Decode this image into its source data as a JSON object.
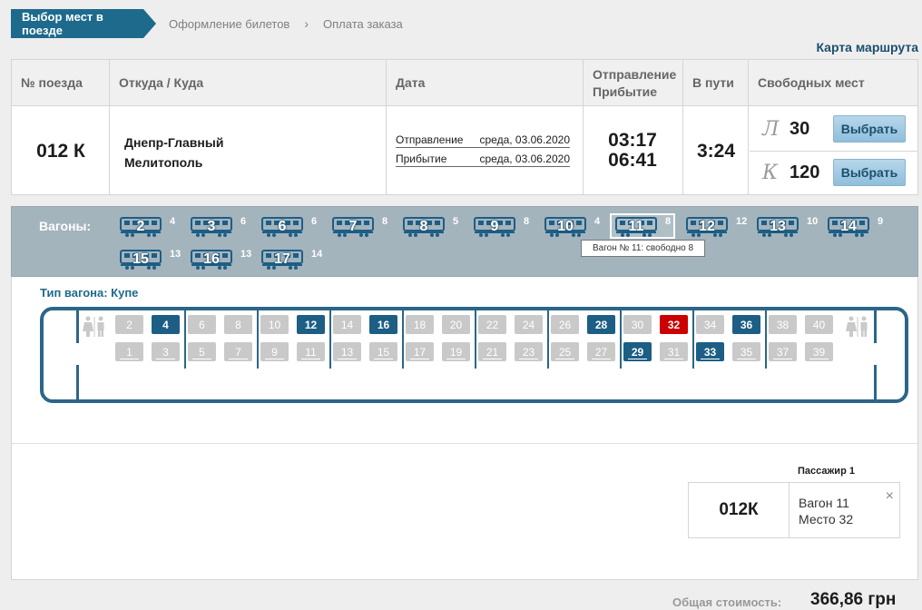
{
  "breadcrumbs": {
    "step1": "Выбор мест в поезде",
    "step2": "Оформление билетов",
    "step3": "Оплата заказа",
    "separator": "›"
  },
  "route_map_link": "Карта маршрута",
  "table": {
    "headers": {
      "train": "№ поезда",
      "route": "Откуда / Куда",
      "date": "Дата",
      "depart_arrive_1": "Отправление",
      "depart_arrive_2": "Прибытие",
      "duration": "В пути",
      "free_seats": "Свободных мест"
    },
    "train_number": "012 К",
    "from": "Днепр-Главный",
    "to": "Мелитополь",
    "departure_label": "Отправление",
    "departure_date": "среда, 03.06.2020",
    "arrival_label": "Прибытие",
    "arrival_date": "среда, 03.06.2020",
    "departure_time": "03:17",
    "arrival_time": "06:41",
    "duration": "3:24",
    "classes": [
      {
        "letter": "Л",
        "count": "30",
        "button": "Выбрать"
      },
      {
        "letter": "К",
        "count": "120",
        "button": "Выбрать"
      }
    ]
  },
  "wagons": {
    "label": "Вагоны:",
    "list": [
      {
        "num": "2",
        "free": "4"
      },
      {
        "num": "3",
        "free": "6"
      },
      {
        "num": "6",
        "free": "6"
      },
      {
        "num": "7",
        "free": "8"
      },
      {
        "num": "8",
        "free": "5"
      },
      {
        "num": "9",
        "free": "8"
      },
      {
        "num": "10",
        "free": "4"
      },
      {
        "num": "11",
        "free": "8"
      },
      {
        "num": "12",
        "free": "12"
      },
      {
        "num": "13",
        "free": "10"
      },
      {
        "num": "14",
        "free": "9"
      },
      {
        "num": "15",
        "free": "13"
      },
      {
        "num": "16",
        "free": "13"
      },
      {
        "num": "17",
        "free": "14"
      }
    ],
    "selected": "11",
    "tooltip": "Вагон № 11: свободно 8"
  },
  "coach": {
    "type_label": "Тип вагона: Купе",
    "busy_seats": [
      "4",
      "12",
      "16",
      "28",
      "29",
      "33",
      "36"
    ],
    "selected_seat": "32"
  },
  "passenger": {
    "label": "Пассажир 1",
    "train": "012К",
    "wagon": "Вагон 11",
    "seat": "Место 32",
    "close": "×"
  },
  "total": {
    "label": "Общая стоимость:",
    "value": "366,86 грн"
  },
  "colors": {
    "primary": "#1d6a8c",
    "busy_seat": "#1d5e85",
    "selected_seat": "#cc0000",
    "free_seat": "#c9c9c9"
  }
}
